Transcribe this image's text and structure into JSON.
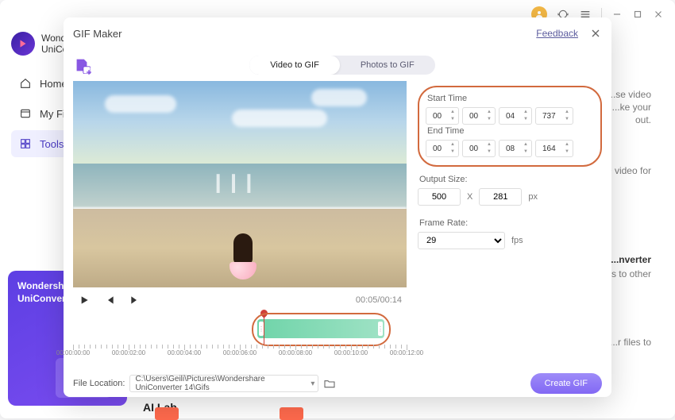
{
  "app": {
    "name": "Wondershare",
    "sub": "UniConverter"
  },
  "nav": {
    "home": "Home",
    "files": "My Files",
    "tools": "Tools"
  },
  "rhs": {
    "t1": "...se video",
    "t2": "...ke your",
    "t3": "out.",
    "t4": "...D video for",
    "t5": "...nverter",
    "t6": "...ges to other",
    "t7": "...r files to"
  },
  "promo": {
    "line1": "Wondershare",
    "line2": "UniConverter"
  },
  "ailab": "AI Lab",
  "modal": {
    "title": "GIF Maker",
    "feedback": "Feedback",
    "tab_video": "Video to GIF",
    "tab_photo": "Photos to GIF"
  },
  "player": {
    "cur": "00:05",
    "dur": "00:14"
  },
  "timeline": {
    "labels": [
      "00:00:00:00",
      "00:00:02:00",
      "00:00:04:00",
      "00:00:06:00",
      "00:00:08:00",
      "00:00:10:00",
      "00:00:12:00"
    ]
  },
  "footer": {
    "label": "File Location:",
    "path": "C:\\Users\\Geili\\Pictures\\Wondershare UniConverter 14\\Gifs",
    "create": "Create GIF"
  },
  "settings": {
    "start_label": "Start Time",
    "start": {
      "h": "00",
      "m": "00",
      "s": "04",
      "ms": "737"
    },
    "end_label": "End Time",
    "end": {
      "h": "00",
      "m": "00",
      "s": "08",
      "ms": "164"
    },
    "size_label": "Output Size:",
    "w": "500",
    "h": "281",
    "x": "X",
    "px": "px",
    "fr_label": "Frame Rate:",
    "fr": "29",
    "fps": "fps"
  }
}
